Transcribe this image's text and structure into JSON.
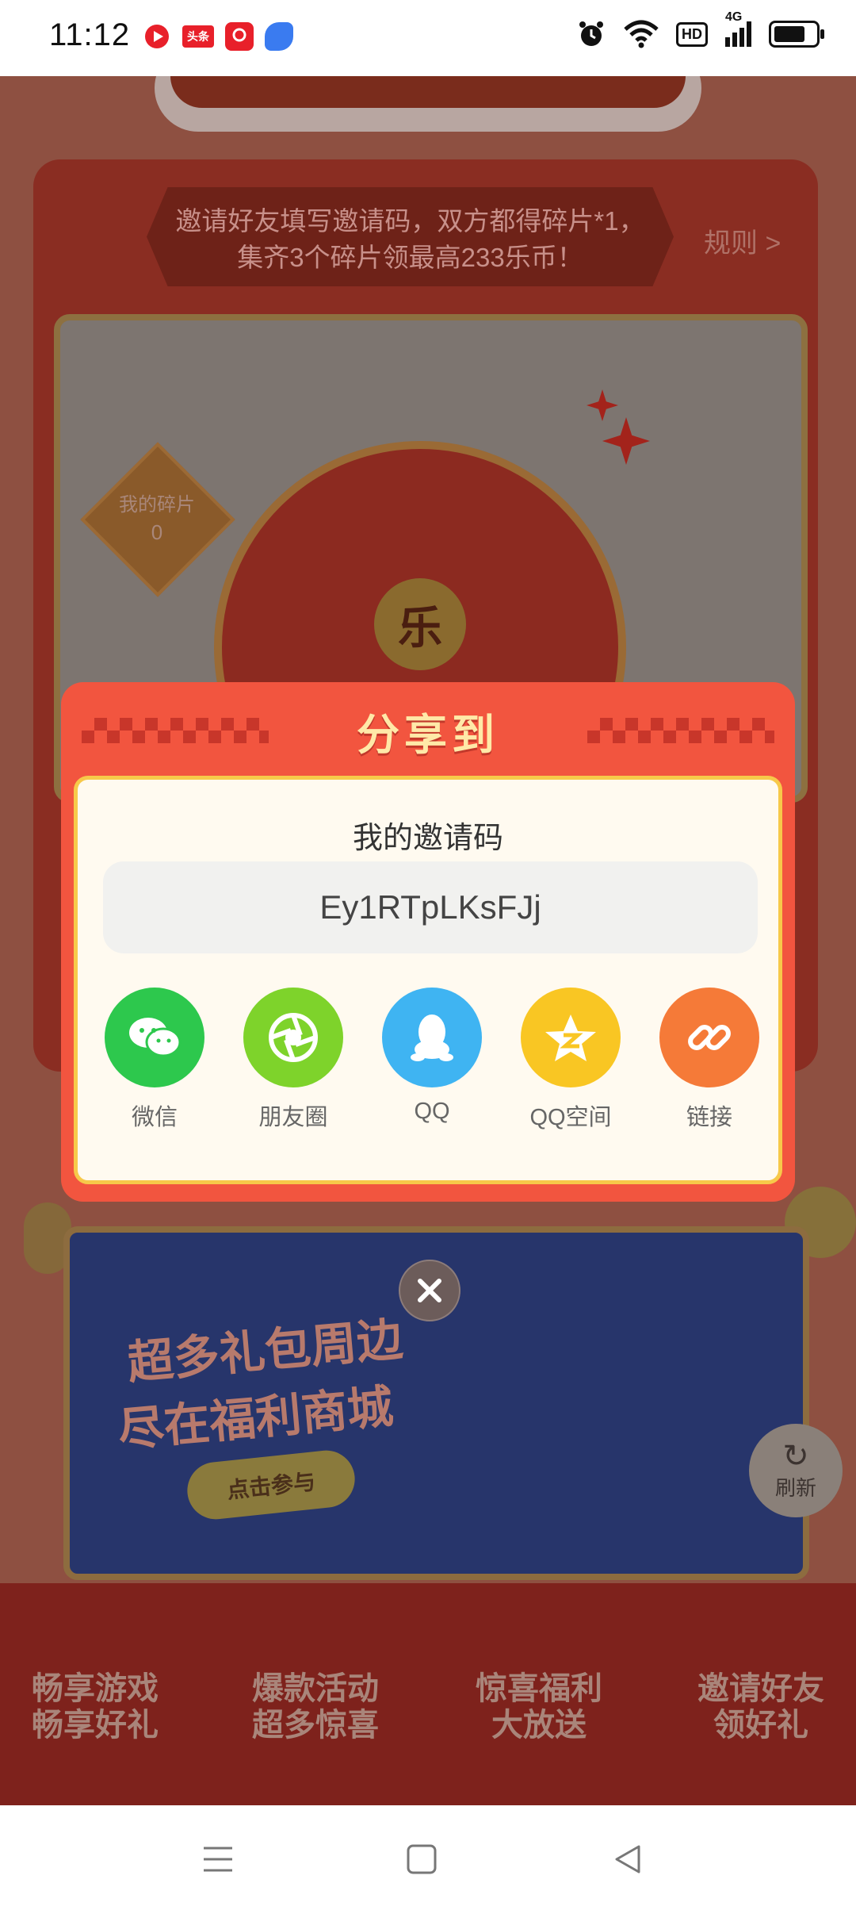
{
  "status_bar": {
    "time": "11:12",
    "app_icons": [
      {
        "name": "video-app-icon",
        "color": "#e8202a",
        "text": ""
      },
      {
        "name": "toutiao-app-icon",
        "color": "#e8202a",
        "text": "头条"
      },
      {
        "name": "app-icon-3",
        "color": "#e8202a",
        "text": ""
      },
      {
        "name": "app-icon-4",
        "color": "#3a7bf0",
        "text": ""
      }
    ],
    "hd": "HD",
    "network": "4G"
  },
  "background": {
    "rules_text": "邀请好友填写邀请码，双方都得碎片*1，集齐3个碎片领最高233乐币！",
    "rules_link": "规则 >",
    "my_shards_label": "我的碎片",
    "my_shards_count": "0",
    "wheel_center": "乐",
    "mall_title_line1": "超多礼包周边",
    "mall_title_line2": "尽在福利商城",
    "mall_button": "点击参与",
    "refresh_label": "刷新",
    "features": [
      {
        "line1": "畅享游戏",
        "line2": "畅享好礼"
      },
      {
        "line1": "爆款活动",
        "line2": "超多惊喜"
      },
      {
        "line1": "惊喜福利",
        "line2": "大放送"
      },
      {
        "line1": "邀请好友",
        "line2": "领好礼"
      }
    ]
  },
  "modal": {
    "title": "分享到",
    "invite_label": "我的邀请码",
    "invite_code": "Ey1RTpLKsFJj",
    "share_options": [
      {
        "label": "微信",
        "icon": "wechat-icon",
        "color": "#2dc84d"
      },
      {
        "label": "朋友圈",
        "icon": "moments-icon",
        "color": "#7ed32b"
      },
      {
        "label": "QQ",
        "icon": "qq-icon",
        "color": "#3fb4f2"
      },
      {
        "label": "QQ空间",
        "icon": "qzone-icon",
        "color": "#f9c623"
      },
      {
        "label": "链接",
        "icon": "link-icon",
        "color": "#f57a38"
      }
    ]
  },
  "colors": {
    "modal_bg": "#f2553f",
    "modal_title": "#ffe9a8",
    "modal_inner_border": "#f7c94a"
  }
}
